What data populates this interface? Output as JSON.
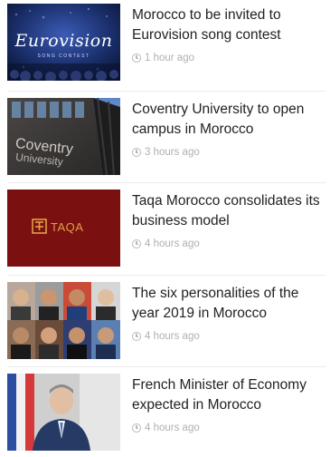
{
  "articles": [
    {
      "title": "Morocco to be invited to Eurovision song contest",
      "time": "1 hour ago",
      "thumb_icon": "eurovision-logo",
      "thumb_text": "Eurovision",
      "thumb_subtext": "SONG CONTEST"
    },
    {
      "title": "Coventry University to open campus in Morocco",
      "time": "3 hours ago",
      "thumb_icon": "coventry-building",
      "thumb_text": "Coventry",
      "thumb_subtext": "University"
    },
    {
      "title": "Taqa Morocco consolidates its business model",
      "time": "4 hours ago",
      "thumb_icon": "taqa-logo",
      "thumb_text": "TAQA"
    },
    {
      "title": "The six personalities of the year 2019 in Morocco",
      "time": "4 hours ago",
      "thumb_icon": "portraits-collage"
    },
    {
      "title": "French Minister of Economy expected in Morocco",
      "time": "4 hours ago",
      "thumb_icon": "minister-photo"
    }
  ],
  "colors": {
    "title": "#222222",
    "time": "#b0b0b0",
    "taqa_bg": "#7a1010",
    "taqa_accent": "#e0a04a",
    "eurovision_bg": "#1a2f6b"
  }
}
